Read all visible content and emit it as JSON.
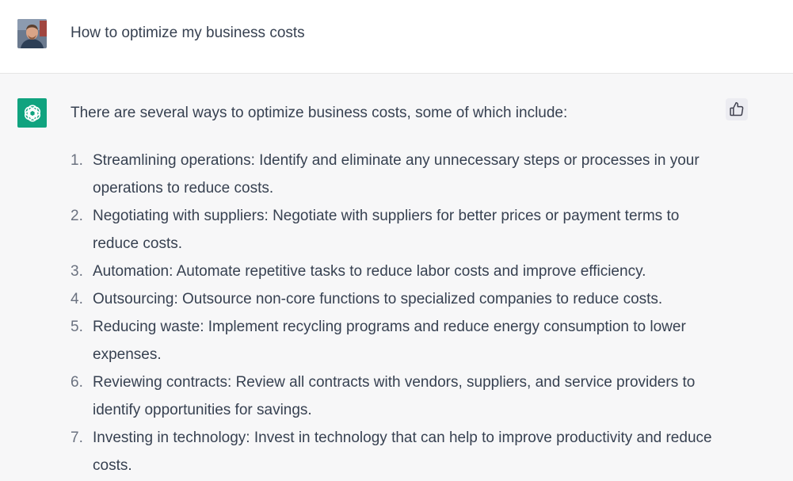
{
  "user_message": {
    "text": "How to optimize my business costs"
  },
  "assistant_message": {
    "intro": "There are several ways to optimize business costs, some of which include:",
    "items": [
      {
        "num": "1.",
        "text": "Streamlining operations: Identify and eliminate any unnecessary steps or processes in your operations to reduce costs."
      },
      {
        "num": "2.",
        "text": "Negotiating with suppliers: Negotiate with suppliers for better prices or payment terms to reduce costs."
      },
      {
        "num": "3.",
        "text": "Automation: Automate repetitive tasks to reduce labor costs and improve efficiency."
      },
      {
        "num": "4.",
        "text": "Outsourcing: Outsource non-core functions to specialized companies to reduce costs."
      },
      {
        "num": "5.",
        "text": "Reducing waste: Implement recycling programs and reduce energy consumption to lower expenses."
      },
      {
        "num": "6.",
        "text": "Reviewing contracts: Review all contracts with vendors, suppliers, and service providers to identify opportunities for savings."
      },
      {
        "num": "7.",
        "text": "Investing in technology: Invest in technology that can help to improve productivity and reduce costs."
      }
    ]
  },
  "icons": {
    "user_avatar": "user-avatar-photo",
    "assistant_avatar": "openai-logo-icon",
    "feedback": "thumbs-up-icon"
  },
  "colors": {
    "brand": "#10a37f",
    "user_bg": "#ffffff",
    "assistant_bg": "#f7f7f8",
    "text": "#374151"
  }
}
